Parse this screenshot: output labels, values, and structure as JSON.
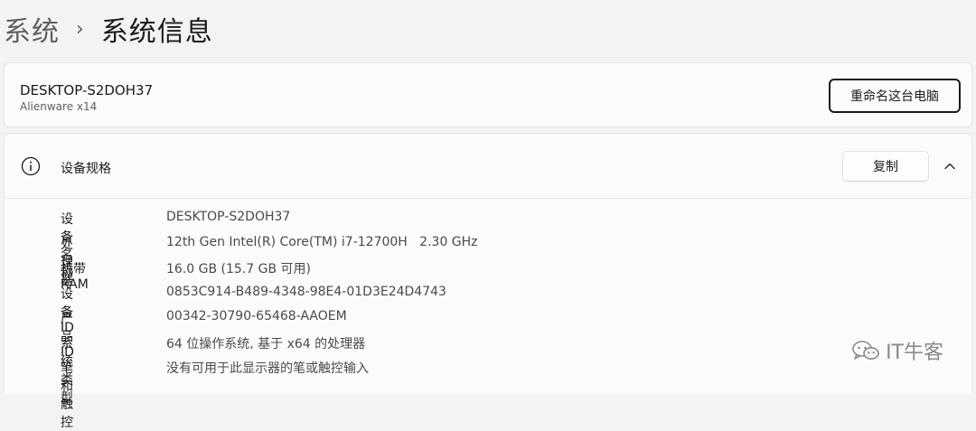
{
  "breadcrumb": {
    "parent": "系统",
    "separator": "›",
    "current": "系统信息"
  },
  "device": {
    "name": "DESKTOP-S2DOH37",
    "model": "Alienware x14",
    "rename_label": "重命名这台电脑"
  },
  "specs": {
    "title": "设备规格",
    "copy_label": "复制",
    "icons": {
      "header": "info-icon",
      "toggle": "chevron-up-icon"
    },
    "rows": [
      {
        "label": "设备名称",
        "value": "DESKTOP-S2DOH37"
      },
      {
        "label": "处理器",
        "value": "12th Gen Intel(R) Core(TM) i7-12700H   2.30 GHz"
      },
      {
        "label": "机带 RAM",
        "value": "16.0 GB (15.7 GB 可用)"
      },
      {
        "label": "设备 ID",
        "value": "0853C914-B489-4348-98E4-01D3E24D4743"
      },
      {
        "label": "产品 ID",
        "value": "00342-30790-65468-AAOEM"
      },
      {
        "label": "系统类型",
        "value": "64 位操作系统, 基于 x64 的处理器"
      },
      {
        "label": "笔和触控",
        "value": "没有可用于此显示器的笔或触控输入"
      }
    ]
  },
  "watermark": {
    "text": "IT牛客",
    "icon": "wechat-icon"
  }
}
